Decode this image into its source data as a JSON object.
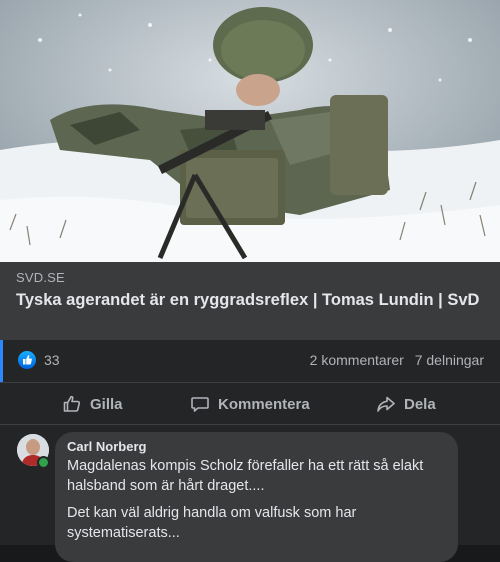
{
  "post": {
    "link_preview": {
      "image_description": "soldier-with-machine-gun-in-snow",
      "domain": "SVD.SE",
      "title": "Tyska agerandet är en ryggradsreflex | Tomas Lundin | SvD"
    },
    "reactions": {
      "count": "33",
      "icon": "like-icon"
    },
    "comments_count": "2 kommentarer",
    "shares_count": "7 delningar",
    "actions": {
      "like_label": "Gilla",
      "comment_label": "Kommentera",
      "share_label": "Dela"
    }
  },
  "comment": {
    "author": "Carl Norberg",
    "paragraph_1": "Magdalenas kompis Scholz förefaller ha ett rätt så elakt halsband som är hårt draget....",
    "paragraph_2": "Det kan väl aldrig handla om valfusk som har systematiserats..."
  },
  "colors": {
    "background": "#18191a",
    "card": "#242526",
    "link_card": "#3a3b3c",
    "text": "#e4e6eb",
    "secondary_text": "#b0b3b8",
    "accent": "#2d88ff",
    "online": "#31a24c"
  }
}
